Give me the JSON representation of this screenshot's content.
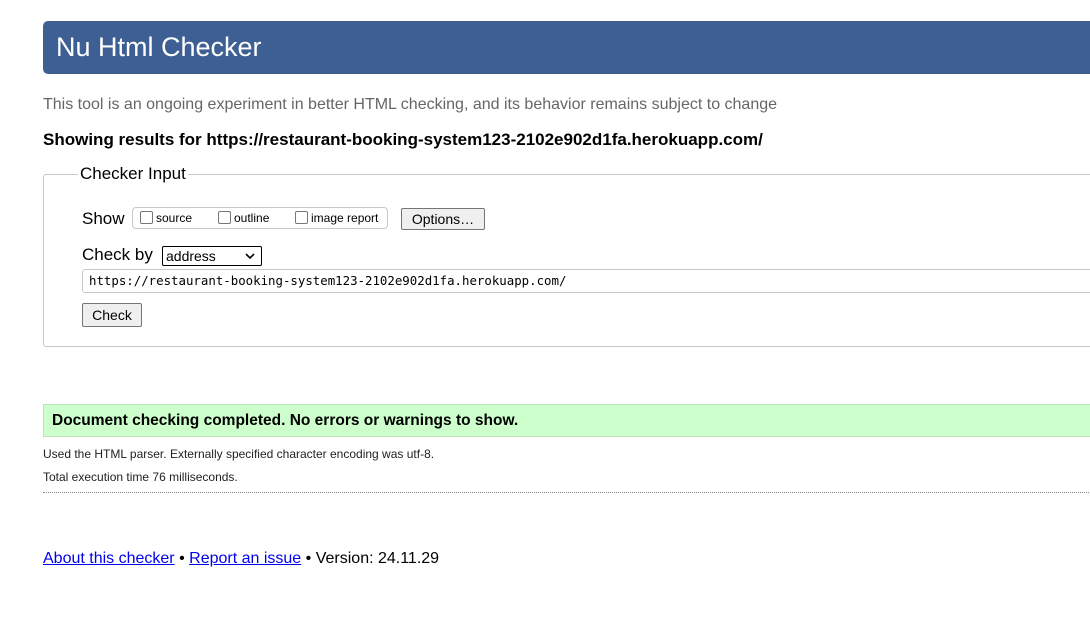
{
  "header": {
    "title": "Nu Html Checker"
  },
  "intro": "This tool is an ongoing experiment in better HTML checking, and its behavior remains subject to change",
  "results_for": "Showing results for https://restaurant-booking-system123-2102e902d1fa.herokuapp.com/",
  "checker_input": {
    "legend": "Checker Input",
    "show_label": "Show",
    "show_options": [
      {
        "label": "source",
        "checked": false
      },
      {
        "label": "outline",
        "checked": false
      },
      {
        "label": "image report",
        "checked": false
      }
    ],
    "options_button": "Options…",
    "check_by_label": "Check by",
    "check_by_selected": "address",
    "url_value": "https://restaurant-booking-system123-2102e902d1fa.herokuapp.com/",
    "check_button": "Check"
  },
  "result": {
    "message": "Document checking completed. No errors or warnings to show.",
    "details": [
      "Used the HTML parser. Externally specified character encoding was utf-8.",
      "Total execution time 76 milliseconds."
    ]
  },
  "footer": {
    "about_link": "About this checker",
    "separator": "•",
    "report_link": "Report an issue",
    "version": "Version: 24.11.29"
  },
  "colors": {
    "header_bg": "#3e5f93",
    "success_bg": "#ccffcc",
    "link": "#0000ee"
  }
}
